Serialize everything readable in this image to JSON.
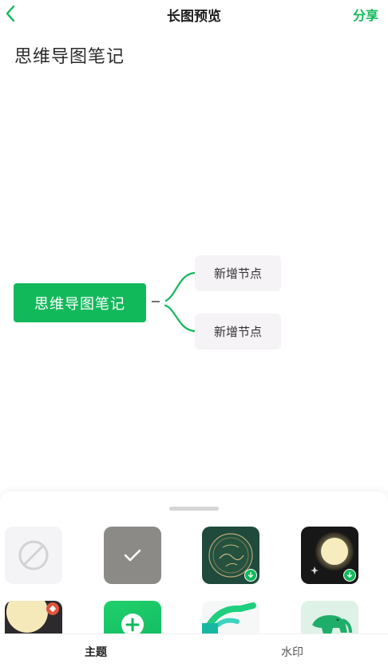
{
  "header": {
    "title": "长图预览",
    "share_label": "分享"
  },
  "note": {
    "title": "思维导图笔记"
  },
  "mindmap": {
    "root_label": "思维导图笔记",
    "children": [
      "新增节点",
      "新增节点"
    ]
  },
  "themes": [
    {
      "name": "none"
    },
    {
      "name": "gray-selected"
    },
    {
      "name": "dark-green-globe"
    },
    {
      "name": "night-moon"
    },
    {
      "name": "sunrise"
    },
    {
      "name": "green-add"
    },
    {
      "name": "green-tracks"
    },
    {
      "name": "green-elephant"
    }
  ],
  "tabs": {
    "theme": "主题",
    "watermark": "水印"
  },
  "colors": {
    "accent": "#12b95b"
  }
}
